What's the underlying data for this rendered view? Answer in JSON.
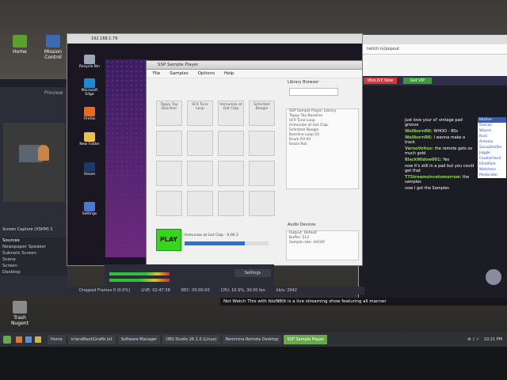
{
  "desktop": {
    "icons": [
      {
        "label": "Home",
        "color": "#5aa02c"
      },
      {
        "label": "Mission Control",
        "color": "#3a6ab0"
      },
      {
        "label": "Trash Nugent",
        "color": "#8a8a8a"
      }
    ]
  },
  "obs": {
    "preview_label": "Preview",
    "sources_header": "Sources",
    "scene_label": "Screen Capture (XSHM) 2",
    "sources": [
      "Newspaper Speaker",
      "Subnets Screen",
      "Scene",
      "Screen",
      "Desktop"
    ],
    "settings_label": "Settings"
  },
  "status_bar": {
    "dropped": "Dropped Frames 0 (0.0%)",
    "live": "LIVE: 02:47:38",
    "rec": "REC: 00:00:00",
    "cpu": "CPU: 10.9%, 30.00 fps",
    "kbps": "kb/s: 2942"
  },
  "remote_window": {
    "title": "192.168.1.79",
    "icons": [
      "Recycle Bin",
      "Microsoft Edge",
      "Firefox",
      "New Folder",
      "Steam",
      "Settings"
    ]
  },
  "ssp_window": {
    "title": "SSP Sample Player",
    "menu": [
      "File",
      "Samples",
      "Options",
      "Help"
    ],
    "pads": [
      "Tappy Tay Bassline",
      "SFX Tune Loop",
      "Immunize at Get Clap",
      "Schnitzel Boogie",
      "",
      "",
      "",
      "",
      "",
      "",
      "",
      "",
      "",
      "",
      "",
      ""
    ],
    "play_label": "PLAY",
    "now_playing": "Immunize at Get Clap - 0:06.3",
    "progress": 0.72,
    "library_header": "Library Browser",
    "library_rows": [
      "SSP Sample Player Library",
      "Tappy Tay Bassline",
      "SFX Tune Loop",
      "Immunize at Get Clap",
      "Schnitzel Boogie",
      "Bassline Loop 02",
      "Drum Fill 04",
      "Snare Roll"
    ],
    "audio_header": "Audio Devices",
    "audio_rows": [
      "Output: Default",
      "Buffer: 512",
      "Sample rate: 44100"
    ]
  },
  "firefox": {
    "url": "twitch.tv/popout",
    "button_live": "IBizLIVE Now",
    "button_vip": "Get VIP",
    "chat": [
      {
        "name": "",
        "text": "just love your ol' vintage pad groove"
      },
      {
        "name": "WellbornRK:",
        "text": "WHOO - 80s"
      },
      {
        "name": "WellbornRK:",
        "text": "I wanna make a track"
      },
      {
        "name": "VernoVoltus:",
        "text": "the remote gets so much gold"
      },
      {
        "name": "BlackWidow001:",
        "text": "Yes"
      },
      {
        "name": "",
        "text": "now it's still in a pad but you could get that"
      },
      {
        "name": "T7Streamsincetomorrow:",
        "text": "the samples"
      },
      {
        "name": "",
        "text": "now I got the Samples"
      }
    ],
    "users": [
      "Ibizlive",
      "Rascali",
      "Wayne",
      "Rudi",
      "Antonio",
      "SiouxDeVille",
      "Jaggle",
      "CookieFiend",
      "ElliotPark",
      "Watchers",
      "Moderator"
    ]
  },
  "ticker": {
    "text": "Not Watch This with IbizNBlit is a live streaming show featuring all manner"
  },
  "taskbar": {
    "items": [
      "Home",
      "inlandRoot/Grafik.txt",
      "Software Manager",
      "OBS Studio 26.1.0 (Linux)",
      "Remmina Remote Desktop",
      "SSP Sample Player"
    ],
    "active_index": 5,
    "clock": "10:21 PM"
  }
}
